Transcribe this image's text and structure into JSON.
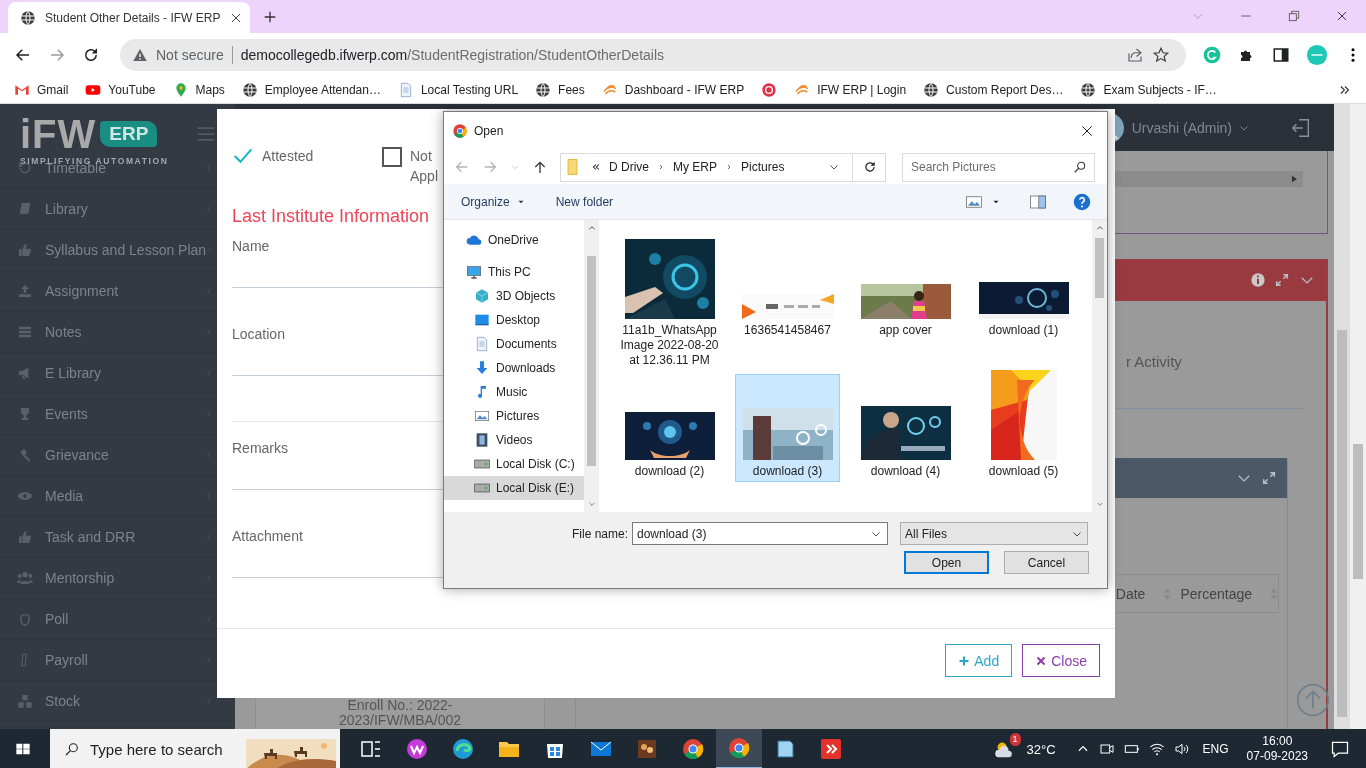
{
  "browser": {
    "tab": {
      "title": "Student Other Details - IFW ERP"
    },
    "security": "Not secure",
    "url_host": "democollegedb.ifwerp.com",
    "url_path": "/StudentRegistration/StudentOtherDetails",
    "bookmarks": [
      {
        "kind": "labeled",
        "label": "Gmail"
      },
      {
        "kind": "labeled",
        "label": "YouTube"
      },
      {
        "kind": "labeled",
        "label": "Maps"
      },
      {
        "kind": "labeled",
        "label": "Employee Attendan…"
      },
      {
        "kind": "labeled",
        "label": "Local Testing URL"
      },
      {
        "kind": "labeled",
        "label": "Fees"
      },
      {
        "kind": "labeled",
        "label": "Dashboard - IFW ERP"
      },
      {
        "kind": "icon_only"
      },
      {
        "kind": "labeled",
        "label": "IFW ERP | Login"
      },
      {
        "kind": "labeled",
        "label": "Custom Report Des…"
      },
      {
        "kind": "labeled",
        "label": "Exam Subjects - IF…"
      }
    ]
  },
  "sidebar": {
    "logo": {
      "name": "iFW",
      "badge": "ERP",
      "tagline": "SIMPLIFYING AUTOMATION"
    },
    "items": [
      {
        "label": "Timetable"
      },
      {
        "label": "Library"
      },
      {
        "label": "Syllabus and Lesson Plan"
      },
      {
        "label": "Assignment"
      },
      {
        "label": "Notes"
      },
      {
        "label": "E Library"
      },
      {
        "label": "Events"
      },
      {
        "label": "Grievance"
      },
      {
        "label": "Media"
      },
      {
        "label": "Task and DRR"
      },
      {
        "label": "Mentorship"
      },
      {
        "label": "Poll"
      },
      {
        "label": "Payroll"
      },
      {
        "label": "Stock"
      }
    ]
  },
  "header": {
    "user": "Urvashi (Admin)"
  },
  "page": {
    "activity_text": "r Activity",
    "columns": [
      {
        "label": "Date"
      },
      {
        "label": "Percentage"
      }
    ],
    "enroll": "Enroll No.: 2022-2023/IFW/MBA/002"
  },
  "modal": {
    "options": [
      {
        "label": "Attested",
        "checked": true
      },
      {
        "label": "Not Appl",
        "checked": false
      }
    ],
    "section_title": "Last Institute Information",
    "fields": [
      {
        "label": "Name",
        "kind": "single"
      },
      {
        "label": "Location",
        "kind": "double"
      },
      {
        "label": "Remarks",
        "kind": "single"
      },
      {
        "label": "Attachment",
        "kind": "single"
      }
    ],
    "buttons": [
      {
        "label": "Add",
        "kind": "add"
      },
      {
        "label": "Close",
        "kind": "close"
      }
    ]
  },
  "file_dialog": {
    "title": "Open",
    "path": [
      "D Drive",
      "My ERP",
      "Pictures"
    ],
    "search": {
      "placeholder": "Search Pictures"
    },
    "organize": "Organize",
    "new_folder": "New folder",
    "tree": [
      {
        "label": "OneDrive",
        "selected": false
      },
      {
        "label": "This PC",
        "selected": false,
        "children": [
          {
            "label": "3D Objects",
            "selected": false
          },
          {
            "label": "Desktop",
            "selected": false
          },
          {
            "label": "Documents",
            "selected": false
          },
          {
            "label": "Downloads",
            "selected": false
          },
          {
            "label": "Music",
            "selected": false
          },
          {
            "label": "Pictures",
            "selected": false
          },
          {
            "label": "Videos",
            "selected": false
          },
          {
            "label": "Local Disk (C:)",
            "selected": false
          },
          {
            "label": "Local Disk (E:)",
            "selected": true
          }
        ]
      }
    ],
    "files": [
      {
        "name": "11a1b_WhatsApp Image 2022-08-20 at 12.36.11 PM",
        "selected": false
      },
      {
        "name": "1636541458467",
        "selected": false
      },
      {
        "name": "app cover",
        "selected": false
      },
      {
        "name": "download (1)",
        "selected": false
      },
      {
        "name": "download (2)",
        "selected": false
      },
      {
        "name": "download (3)",
        "selected": true
      },
      {
        "name": "download (4)",
        "selected": false
      },
      {
        "name": "download (5)",
        "selected": false
      }
    ],
    "file_name_label": "File name:",
    "file_name": "download (3)",
    "file_type": "All Files",
    "buttons": [
      {
        "label": "Open",
        "kind": "primary"
      },
      {
        "label": "Cancel",
        "kind": "secondary"
      }
    ]
  },
  "taskbar": {
    "search": {
      "placeholder": "Type here to search"
    },
    "apps": [
      {
        "active": false
      },
      {
        "active": false
      },
      {
        "active": false
      },
      {
        "active": false
      },
      {
        "active": false
      },
      {
        "active": false
      },
      {
        "active": false
      },
      {
        "active": false
      },
      {
        "active": true
      },
      {
        "active": false
      },
      {
        "active": false
      }
    ],
    "weather": {
      "badge": "1",
      "temp": "32°C"
    },
    "language": "ENG",
    "time": "16:00",
    "date": "07-09-2023"
  }
}
